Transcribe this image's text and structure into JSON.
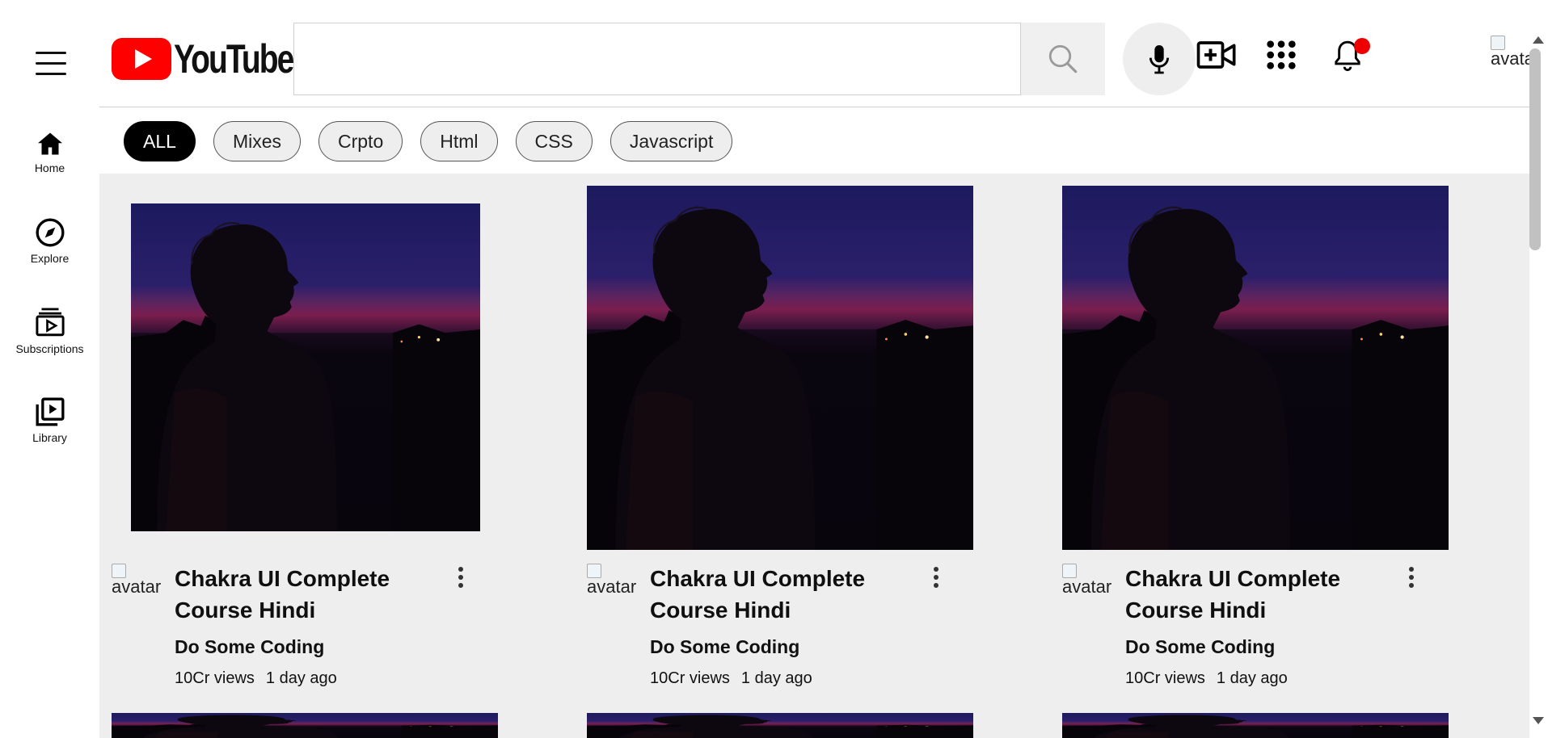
{
  "brand": {
    "name": "YouTube",
    "red": "#FF0000"
  },
  "search": {
    "placeholder": "",
    "value": ""
  },
  "header_icons": [
    "search-icon",
    "microphone-icon",
    "create-video-icon",
    "apps-grid-icon",
    "notifications-bell-icon"
  ],
  "header_avatar_alt": "avatar",
  "sidebar": {
    "items": [
      {
        "label": "Home",
        "icon": "home-icon"
      },
      {
        "label": "Explore",
        "icon": "compass-icon"
      },
      {
        "label": "Subscriptions",
        "icon": "subscriptions-icon"
      },
      {
        "label": "Library",
        "icon": "library-icon"
      }
    ]
  },
  "chips": [
    "ALL",
    "Mixes",
    "Crpto",
    "Html",
    "CSS",
    "Javascript"
  ],
  "active_chip": "ALL",
  "videos": [
    {
      "title": "Chakra UI Complete Course Hindi",
      "channel": "Do Some Coding",
      "views": "10Cr views",
      "age": "1 day ago",
      "avatar_alt": "avatar"
    },
    {
      "title": "Chakra UI Complete Course Hindi",
      "channel": "Do Some Coding",
      "views": "10Cr views",
      "age": "1 day ago",
      "avatar_alt": "avatar"
    },
    {
      "title": "Chakra UI Complete Course Hindi",
      "channel": "Do Some Coding",
      "views": "10Cr views",
      "age": "1 day ago",
      "avatar_alt": "avatar"
    }
  ],
  "colors": {
    "content_bg": "#efeeee",
    "chip_bg": "#eeeeee",
    "notification": "#e00000"
  }
}
